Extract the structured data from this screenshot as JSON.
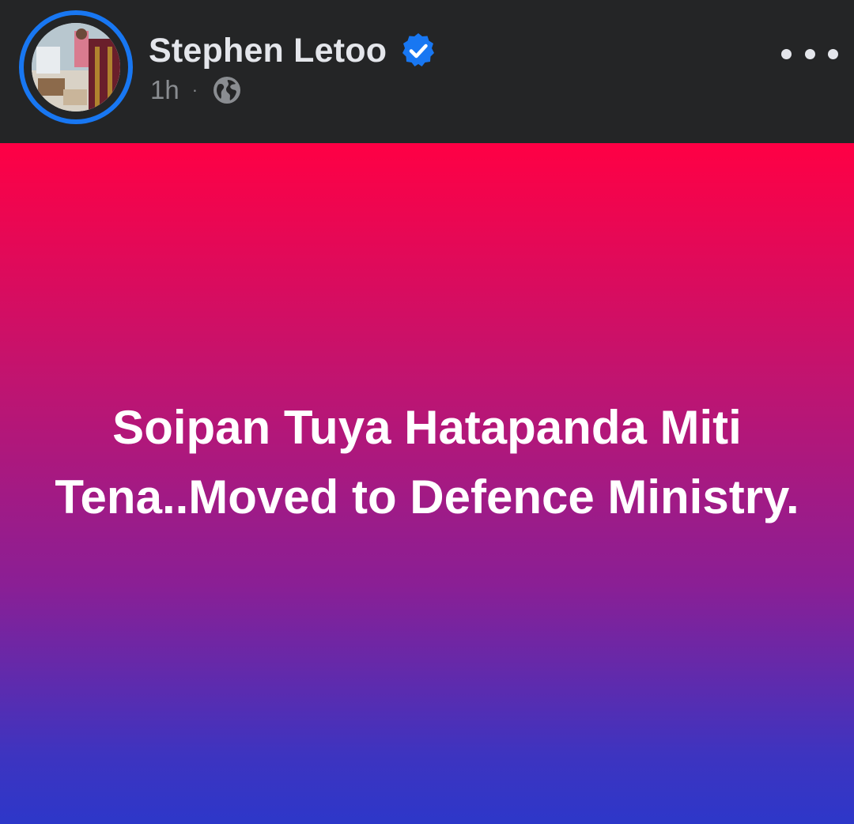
{
  "header": {
    "author_name": "Stephen Letoo",
    "verified": true,
    "timestamp": "1h",
    "separator": "·",
    "audience_icon": "globe-icon",
    "more_icon": "more-horizontal-icon"
  },
  "post": {
    "text": "Soipan Tuya Hatapanda Miti Tena..Moved to Defence Ministry.",
    "background_gradient": [
      "#ff0044",
      "#2d37c9"
    ],
    "text_color": "#ffffff"
  },
  "colors": {
    "header_bg": "#242526",
    "accent": "#1877f2",
    "name": "#e4e6eb",
    "meta": "#8a8d91"
  }
}
